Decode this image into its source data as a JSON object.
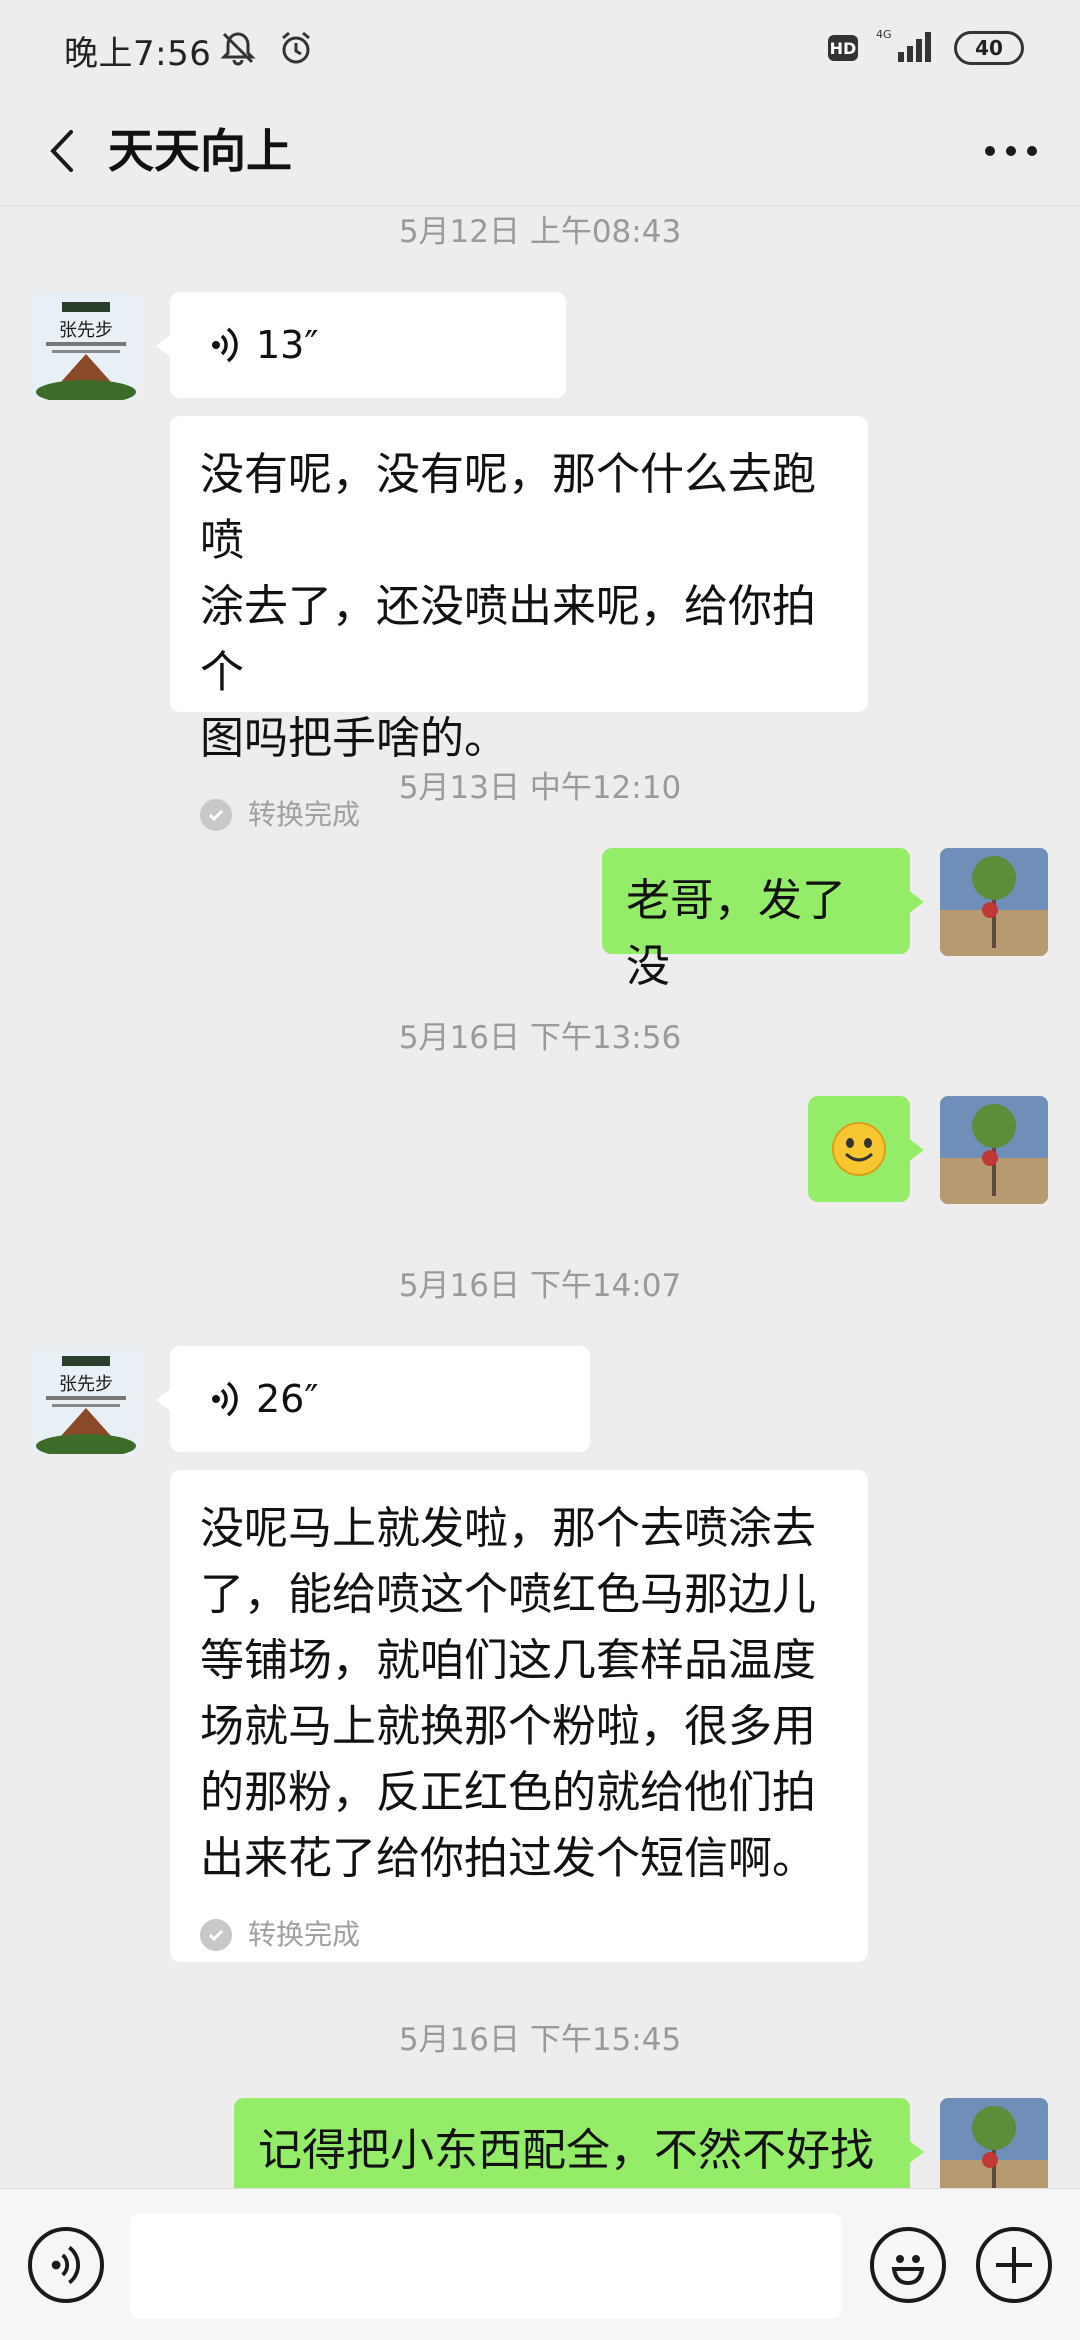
{
  "status_bar": {
    "time": "晚上7:56",
    "hd": "HD",
    "network": "4G",
    "battery": "40"
  },
  "header": {
    "title": "天天向上"
  },
  "messages": [
    {
      "type": "timestamp",
      "text": "5月12日 上午08:43"
    },
    {
      "type": "voice",
      "side": "left",
      "duration": "13″",
      "transcript": "没有呢，没有呢，那个什么去跑喷\n涂去了，还没喷出来呢，给你拍个\n图吗把手啥的。",
      "status": "转换完成"
    },
    {
      "type": "timestamp",
      "text": "5月13日 中午12:10"
    },
    {
      "type": "text",
      "side": "right",
      "text": "老哥，发了没"
    },
    {
      "type": "timestamp",
      "text": "5月16日 下午13:56"
    },
    {
      "type": "emoji",
      "side": "right",
      "emoji": "smile-emoji"
    },
    {
      "type": "timestamp",
      "text": "5月16日 下午14:07"
    },
    {
      "type": "voice",
      "side": "left",
      "duration": "26″",
      "transcript": "没呢马上就发啦，那个去喷涂去\n了，能给喷这个喷红色马那边儿\n等铺场，就咱们这几套样品温度\n场就马上就换那个粉啦，很多用\n的那粉，反正红色的就给他们拍\n出来花了给你拍过发个短信啊。",
      "status": "转换完成"
    },
    {
      "type": "timestamp",
      "text": "5月16日 下午15:45"
    },
    {
      "type": "text",
      "side": "right",
      "text": "记得把小东西配全，不然不好找"
    }
  ],
  "input": {
    "value": "",
    "placeholder": ""
  },
  "colors": {
    "background": "#ededed",
    "sent_bubble": "#95ec69",
    "received_bubble": "#ffffff",
    "timestamp": "#9a9a9a"
  },
  "avatars": {
    "contact_text": "张先步"
  }
}
